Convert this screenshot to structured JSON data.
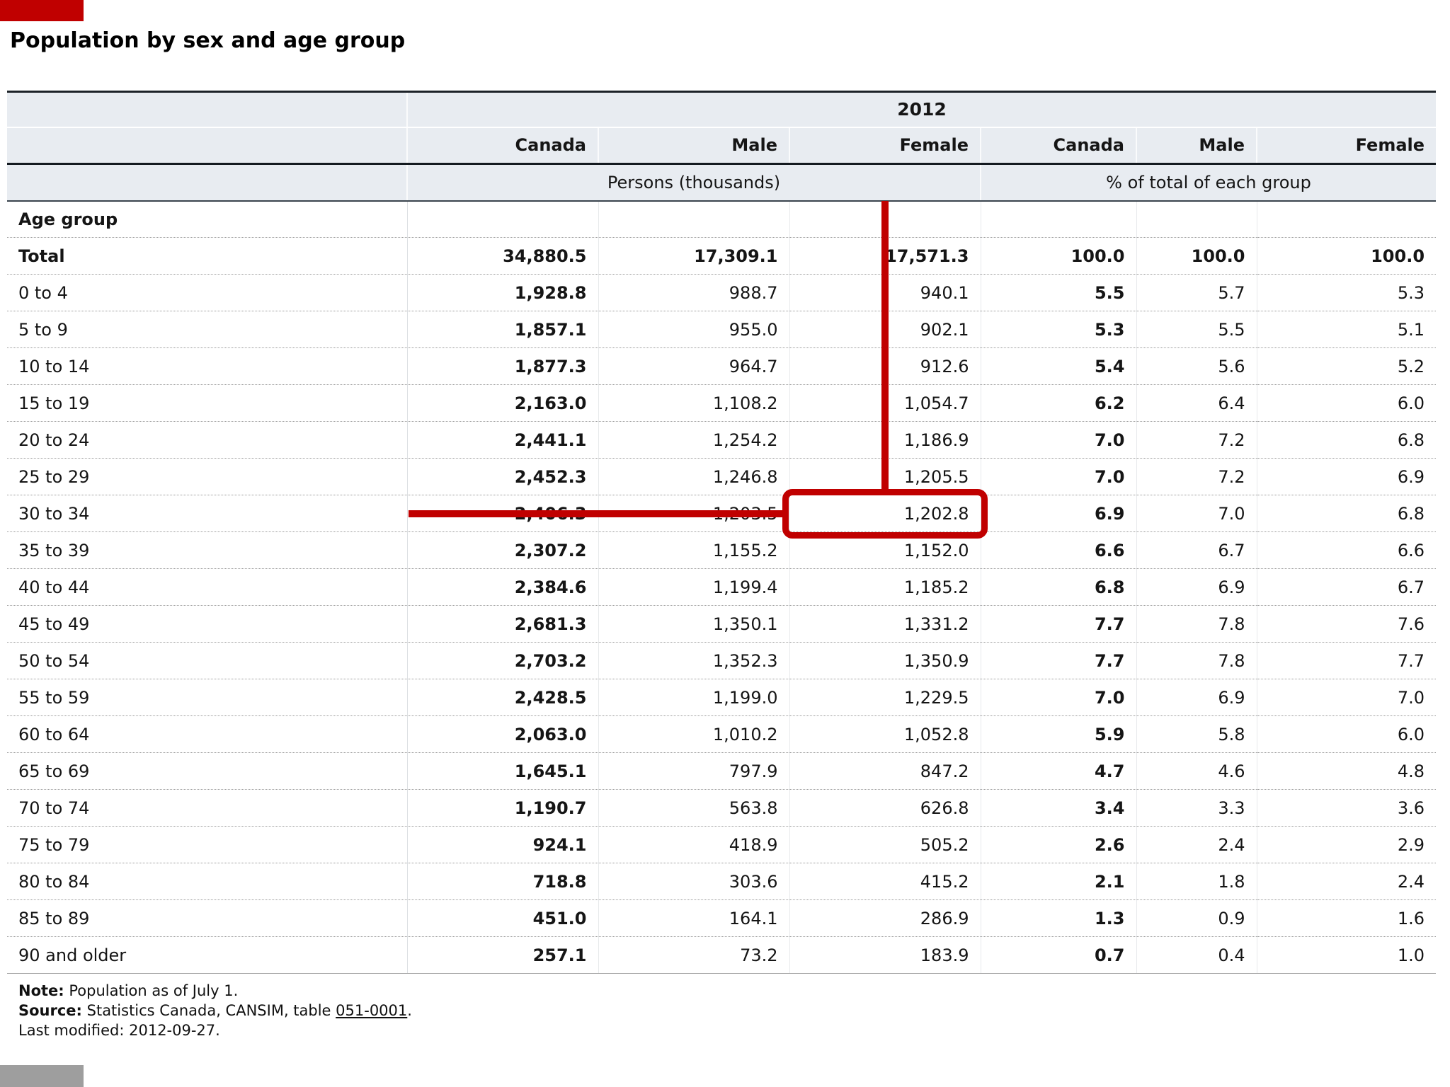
{
  "page": {
    "title": "Population by sex and age group"
  },
  "table": {
    "year": "2012",
    "column_headers": [
      "Canada",
      "Male",
      "Female",
      "Canada",
      "Male",
      "Female"
    ],
    "unit_group_headers": [
      "Persons (thousands)",
      "% of total of each group"
    ],
    "section_label": "Age group",
    "rows": [
      {
        "label": "Total",
        "total": true,
        "values": [
          "34,880.5",
          "17,309.1",
          "17,571.3",
          "100.0",
          "100.0",
          "100.0"
        ]
      },
      {
        "label": "0 to 4",
        "values": [
          "1,928.8",
          "988.7",
          "940.1",
          "5.5",
          "5.7",
          "5.3"
        ]
      },
      {
        "label": "5 to 9",
        "values": [
          "1,857.1",
          "955.0",
          "902.1",
          "5.3",
          "5.5",
          "5.1"
        ]
      },
      {
        "label": "10 to 14",
        "values": [
          "1,877.3",
          "964.7",
          "912.6",
          "5.4",
          "5.6",
          "5.2"
        ]
      },
      {
        "label": "15 to 19",
        "values": [
          "2,163.0",
          "1,108.2",
          "1,054.7",
          "6.2",
          "6.4",
          "6.0"
        ]
      },
      {
        "label": "20 to 24",
        "values": [
          "2,441.1",
          "1,254.2",
          "1,186.9",
          "7.0",
          "7.2",
          "6.8"
        ]
      },
      {
        "label": "25 to 29",
        "values": [
          "2,452.3",
          "1,246.8",
          "1,205.5",
          "7.0",
          "7.2",
          "6.9"
        ]
      },
      {
        "label": "30 to 34",
        "values": [
          "2,406.3",
          "1,203.5",
          "1,202.8",
          "6.9",
          "7.0",
          "6.8"
        ]
      },
      {
        "label": "35 to 39",
        "values": [
          "2,307.2",
          "1,155.2",
          "1,152.0",
          "6.6",
          "6.7",
          "6.6"
        ]
      },
      {
        "label": "40 to 44",
        "values": [
          "2,384.6",
          "1,199.4",
          "1,185.2",
          "6.8",
          "6.9",
          "6.7"
        ]
      },
      {
        "label": "45 to 49",
        "values": [
          "2,681.3",
          "1,350.1",
          "1,331.2",
          "7.7",
          "7.8",
          "7.6"
        ]
      },
      {
        "label": "50 to 54",
        "values": [
          "2,703.2",
          "1,352.3",
          "1,350.9",
          "7.7",
          "7.8",
          "7.7"
        ]
      },
      {
        "label": "55 to 59",
        "values": [
          "2,428.5",
          "1,199.0",
          "1,229.5",
          "7.0",
          "6.9",
          "7.0"
        ]
      },
      {
        "label": "60 to 64",
        "values": [
          "2,063.0",
          "1,010.2",
          "1,052.8",
          "5.9",
          "5.8",
          "6.0"
        ]
      },
      {
        "label": "65 to 69",
        "values": [
          "1,645.1",
          "797.9",
          "847.2",
          "4.7",
          "4.6",
          "4.8"
        ]
      },
      {
        "label": "70 to 74",
        "values": [
          "1,190.7",
          "563.8",
          "626.8",
          "3.4",
          "3.3",
          "3.6"
        ]
      },
      {
        "label": "75 to 79",
        "values": [
          "924.1",
          "418.9",
          "505.2",
          "2.6",
          "2.4",
          "2.9"
        ]
      },
      {
        "label": "80 to 84",
        "values": [
          "718.8",
          "303.6",
          "415.2",
          "2.1",
          "1.8",
          "2.4"
        ]
      },
      {
        "label": "85 to 89",
        "values": [
          "451.0",
          "164.1",
          "286.9",
          "1.3",
          "0.9",
          "1.6"
        ]
      },
      {
        "label": "90 and older",
        "values": [
          "257.1",
          "73.2",
          "183.9",
          "0.7",
          "0.4",
          "1.0"
        ]
      }
    ]
  },
  "notes": {
    "note_label": "Note:",
    "note_text": " Population as of July 1.",
    "source_label": "Source:",
    "source_before_link": " Statistics Canada, CANSIM, table ",
    "source_link": "051-0001",
    "source_after_link": ".",
    "last_modified": "Last modified: 2012-09-27."
  },
  "annotation": {
    "color": "#c00000",
    "target_row": "30 to 34",
    "target_column": "Female",
    "target_value": "1,202.8",
    "boxed_value_index": 2
  },
  "artifacts": {
    "top_left_block_color": "#c00000",
    "bottom_left_block_color": "#9e9e9e"
  }
}
